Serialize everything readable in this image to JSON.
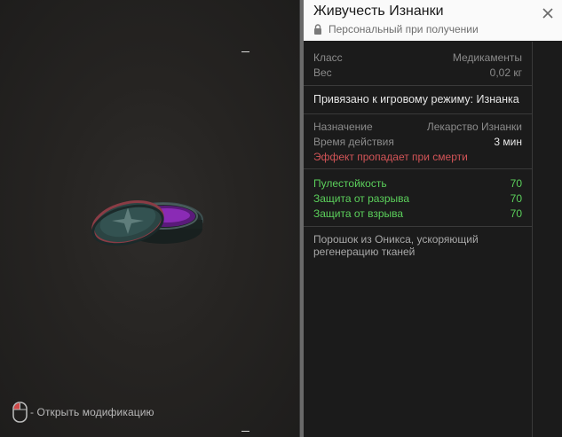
{
  "item": {
    "title": "Живучесть Изнанки",
    "binding": "Персональный при получении"
  },
  "basic": {
    "class_label": "Класс",
    "class_value": "Медикаменты",
    "weight_label": "Вес",
    "weight_value": "0,02 кг"
  },
  "mode_binding": "Привязано к игровому режиму: Изнанка",
  "usage": {
    "purpose_label": "Назначение",
    "purpose_value": "Лекарство Изнанки",
    "duration_label": "Время действия",
    "duration_value": "3 мин",
    "warning": "Эффект пропадает при смерти"
  },
  "stats": [
    {
      "label": "Пулестойкость",
      "value": "70"
    },
    {
      "label": "Защита от разрыва",
      "value": "70"
    },
    {
      "label": "Защита от взрыва",
      "value": "70"
    }
  ],
  "description": "Порошок из Оникса, ускоряющий регенерацию тканей",
  "hint": {
    "text": "- Открыть модификацию"
  },
  "icons": {
    "lock": "lock-icon",
    "close": "close-icon",
    "mouse": "mouse-left-click-icon"
  },
  "colors": {
    "warning": "#d25457",
    "stat": "#5bd05b"
  }
}
